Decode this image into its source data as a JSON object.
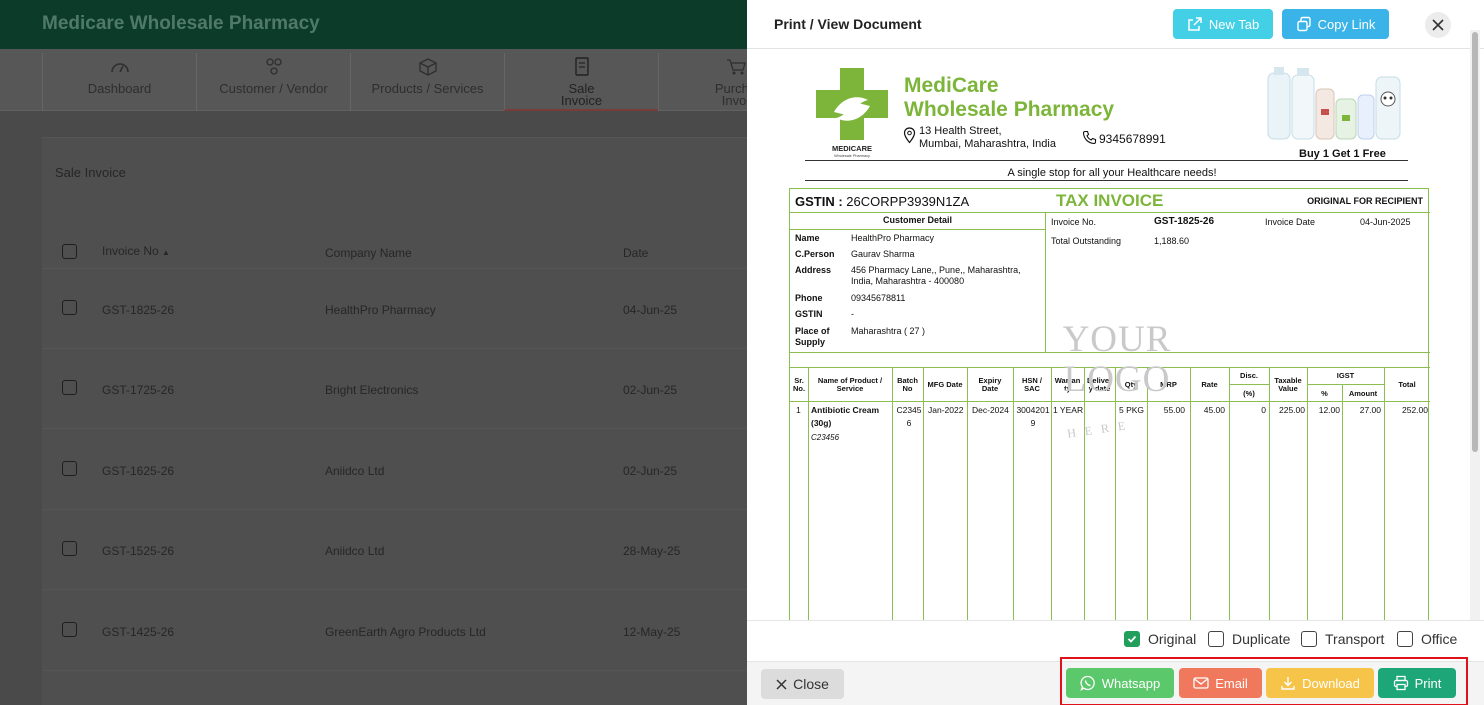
{
  "app": {
    "title": "Medicare Wholesale Pharmacy",
    "nav": [
      {
        "l1": "Dashboard",
        "l2": ""
      },
      {
        "l1": "Customer / Vendor",
        "l2": ""
      },
      {
        "l1": "Products / Services",
        "l2": ""
      },
      {
        "l1": "Sale",
        "l2": "Invoice"
      },
      {
        "l1": "Purcha",
        "l2": "Invoi"
      }
    ]
  },
  "list": {
    "card_title": "Sale Invoice",
    "headers": {
      "invoice": "Invoice No",
      "sort": "▲",
      "company": "Company Name",
      "date": "Date"
    },
    "rows": [
      {
        "invoice": "GST-1825-26",
        "company": "HealthPro Pharmacy",
        "date": "04-Jun-25"
      },
      {
        "invoice": "GST-1725-26",
        "company": "Bright Electronics",
        "date": "02-Jun-25"
      },
      {
        "invoice": "GST-1625-26",
        "company": "Aniidco Ltd",
        "date": "02-Jun-25"
      },
      {
        "invoice": "GST-1525-26",
        "company": "Aniidco Ltd",
        "date": "28-May-25"
      },
      {
        "invoice": "GST-1425-26",
        "company": "GreenEarth Agro Products Ltd",
        "date": "12-May-25"
      }
    ]
  },
  "drawer": {
    "title": "Print / View Document",
    "new_tab": "New Tab",
    "copy_link": "Copy Link"
  },
  "doc": {
    "company_l1": "MediCare",
    "company_l2": "Wholesale Pharmacy",
    "logo_text": "MEDICARE",
    "logo_sub": "Wholesale Pharmacy",
    "address_l1": "13 Health Street,",
    "address_l2": "Mumbai, Maharashtra, India",
    "phone": "9345678991",
    "promo": "Buy 1 Get 1 Free",
    "tagline": "A single stop for all your Healthcare needs!",
    "gstin_label": "GSTIN :",
    "gstin_value": "26CORPP3939N1ZA",
    "tax_invoice": "TAX INVOICE",
    "copy_type": "ORIGINAL FOR RECIPIENT",
    "customer_detail": "Customer Detail",
    "customer": {
      "name_k": "Name",
      "name": "HealthPro Pharmacy",
      "cperson_k": "C.Person",
      "cperson": "Gaurav Sharma",
      "address_k": "Address",
      "address": "456 Pharmacy Lane,, Pune,, Maharashtra, India, Maharashtra - 400080",
      "phone_k": "Phone",
      "phone": "09345678811",
      "gstin_k": "GSTIN",
      "gstin": "-",
      "pos_k1": "Place of",
      "pos_k2": "Supply",
      "pos": "Maharashtra ( 27 )"
    },
    "invoice": {
      "no_k": "Invoice No.",
      "no": "GST-1825-26",
      "date_k": "Invoice Date",
      "date": "04-Jun-2025",
      "out_k": "Total Outstanding",
      "out": "1,188.60"
    },
    "cols": {
      "sr1": "Sr.",
      "sr2": "No.",
      "name1": "Name of Product /",
      "name2": "Service",
      "batch1": "Batch",
      "batch2": "No",
      "mfg": "MFG Date",
      "exp1": "Expiry",
      "exp2": "Date",
      "hsn1": "HSN /",
      "hsn2": "SAC",
      "war1": "Warran",
      "war2": "ty",
      "del1": "Deliver",
      "del2": "y date",
      "qty": "Qty",
      "mrp": "MRP",
      "rate": "Rate",
      "disc1": "Disc.",
      "disc2": "(%)",
      "tax1": "Taxable",
      "tax2": "Value",
      "igst": "IGST",
      "pct": "%",
      "amt": "Amount",
      "total": "Total"
    },
    "item": {
      "sr": "1",
      "name1": "Antibiotic Cream",
      "name2": "(30g)",
      "code": "C23456",
      "batch1": "C2345",
      "batch2": "6",
      "mfg": "Jan-2022",
      "exp": "Dec-2024",
      "hsn1": "3004201",
      "hsn2": "9",
      "war": "1 YEAR",
      "qty": "5 PKG",
      "mrp": "55.00",
      "rate": "45.00",
      "disc": "0",
      "taxable": "225.00",
      "pct": "12.00",
      "amt": "27.00",
      "total": "252.00"
    },
    "watermark_l1": "YOUR",
    "watermark_l2": "LOGO",
    "watermark_l3": "HERE"
  },
  "copies": {
    "original": "Original",
    "duplicate": "Duplicate",
    "transport": "Transport",
    "office": "Office"
  },
  "actions": {
    "close": "Close",
    "whatsapp": "Whatsapp",
    "email": "Email",
    "download": "Download",
    "print": "Print"
  },
  "colors": {
    "brand_green": "#7cb53a",
    "header_dark": "#0d3b2a",
    "whatsapp": "#5bc86b",
    "email": "#f0795d",
    "download": "#f7c44a",
    "print": "#1da779",
    "highlight": "#e0111a"
  }
}
